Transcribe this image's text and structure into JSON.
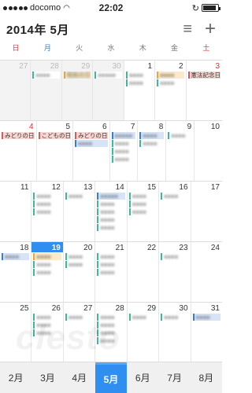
{
  "status": {
    "carrier": "docomo",
    "time": "22:02",
    "icons": [
      "signal-dots",
      "wifi-icon",
      "rotation-lock-icon",
      "battery-icon"
    ]
  },
  "header": {
    "title": "2014年 5月",
    "list_icon": "≡",
    "add_icon": "+"
  },
  "weekdays": [
    "日",
    "月",
    "火",
    "水",
    "木",
    "金",
    "土"
  ],
  "weeks": [
    [
      {
        "n": "27",
        "out": true,
        "events": []
      },
      {
        "n": "28",
        "out": true,
        "events": [
          {
            "t": "●●●●",
            "c": "teal",
            "b": true
          }
        ]
      },
      {
        "n": "29",
        "out": true,
        "events": [
          {
            "t": "昭和の日",
            "c": "orange",
            "b": true
          }
        ]
      },
      {
        "n": "30",
        "out": true,
        "events": [
          {
            "t": "●●●●●",
            "c": "teal",
            "b": true
          }
        ]
      },
      {
        "n": "1",
        "events": [
          {
            "t": "●●●●",
            "c": "teal",
            "b": true
          },
          {
            "t": "●●●●",
            "c": "teal",
            "b": true
          }
        ]
      },
      {
        "n": "2",
        "events": [
          {
            "t": "●●●●",
            "c": "orange",
            "b": true
          },
          {
            "t": "●●●●",
            "c": "teal",
            "b": true
          }
        ]
      },
      {
        "n": "3",
        "sat": true,
        "events": [
          {
            "t": "憲法記念日",
            "c": "red",
            "b": false
          }
        ]
      }
    ],
    [
      {
        "n": "4",
        "sun": true,
        "events": [
          {
            "t": "みどりの日",
            "c": "red",
            "b": false
          }
        ]
      },
      {
        "n": "5",
        "events": [
          {
            "t": "こどもの日",
            "c": "red",
            "b": false
          }
        ]
      },
      {
        "n": "6",
        "events": [
          {
            "t": "みどりの日",
            "c": "red",
            "b": false
          },
          {
            "t": "●●●●",
            "c": "blue",
            "b": true
          }
        ]
      },
      {
        "n": "7",
        "events": [
          {
            "t": "●●●●●",
            "c": "blue",
            "b": true
          },
          {
            "t": "●●●●",
            "c": "teal",
            "b": true
          },
          {
            "t": "●●●●",
            "c": "teal",
            "b": true
          },
          {
            "t": "●●●●",
            "c": "teal",
            "b": true
          }
        ]
      },
      {
        "n": "8",
        "events": [
          {
            "t": "●●●●",
            "c": "blue",
            "b": true
          },
          {
            "t": "●●●●",
            "c": "teal",
            "b": true
          }
        ]
      },
      {
        "n": "9",
        "events": [
          {
            "t": "●●●●",
            "c": "teal",
            "b": true
          }
        ]
      },
      {
        "n": "10",
        "events": []
      }
    ],
    [
      {
        "n": "11",
        "events": []
      },
      {
        "n": "12",
        "events": [
          {
            "t": "●●●●",
            "c": "teal",
            "b": true
          },
          {
            "t": "●●●●",
            "c": "teal",
            "b": true
          },
          {
            "t": "●●●●",
            "c": "teal",
            "b": true
          }
        ]
      },
      {
        "n": "13",
        "events": [
          {
            "t": "●●●●",
            "c": "teal",
            "b": true
          }
        ]
      },
      {
        "n": "14",
        "events": [
          {
            "t": "●●●●●",
            "c": "blue",
            "b": true
          },
          {
            "t": "●●●●",
            "c": "teal",
            "b": true
          },
          {
            "t": "●●●●",
            "c": "teal",
            "b": true
          },
          {
            "t": "●●●●",
            "c": "teal",
            "b": true
          },
          {
            "t": "●●●●",
            "c": "teal",
            "b": true
          }
        ]
      },
      {
        "n": "15",
        "events": [
          {
            "t": "●●●●",
            "c": "teal",
            "b": true
          },
          {
            "t": "●●●●",
            "c": "teal",
            "b": true
          },
          {
            "t": "●●●●",
            "c": "teal",
            "b": true
          }
        ]
      },
      {
        "n": "16",
        "events": [
          {
            "t": "●●●●",
            "c": "teal",
            "b": true
          }
        ]
      },
      {
        "n": "17",
        "events": []
      }
    ],
    [
      {
        "n": "18",
        "events": [
          {
            "t": "●●●●",
            "c": "blue",
            "b": true
          }
        ]
      },
      {
        "n": "19",
        "today": true,
        "events": [
          {
            "t": "●●●●",
            "c": "orange",
            "b": true
          },
          {
            "t": "●●●●",
            "c": "teal",
            "b": true
          },
          {
            "t": "●●●●",
            "c": "teal",
            "b": true
          }
        ]
      },
      {
        "n": "20",
        "events": [
          {
            "t": "●●●●",
            "c": "teal",
            "b": true
          },
          {
            "t": "●●●●",
            "c": "teal",
            "b": true
          }
        ]
      },
      {
        "n": "21",
        "events": [
          {
            "t": "●●●●",
            "c": "teal",
            "b": true
          },
          {
            "t": "●●●●",
            "c": "teal",
            "b": true
          },
          {
            "t": "●●●●",
            "c": "teal",
            "b": true
          }
        ]
      },
      {
        "n": "22",
        "events": []
      },
      {
        "n": "23",
        "events": [
          {
            "t": "●●●●",
            "c": "teal",
            "b": true
          }
        ]
      },
      {
        "n": "24",
        "events": []
      }
    ],
    [
      {
        "n": "25",
        "events": []
      },
      {
        "n": "26",
        "events": [
          {
            "t": "●●●●",
            "c": "teal",
            "b": true
          },
          {
            "t": "●●●●",
            "c": "teal",
            "b": true
          },
          {
            "t": "●●●●",
            "c": "teal",
            "b": true
          }
        ]
      },
      {
        "n": "27",
        "events": [
          {
            "t": "●●●●",
            "c": "teal",
            "b": true
          }
        ]
      },
      {
        "n": "28",
        "events": [
          {
            "t": "●●●●",
            "c": "teal",
            "b": true
          },
          {
            "t": "●●●●",
            "c": "teal",
            "b": true
          },
          {
            "t": "●●●●",
            "c": "teal",
            "b": true
          },
          {
            "t": "●●●●",
            "c": "teal",
            "b": true
          }
        ]
      },
      {
        "n": "29",
        "events": [
          {
            "t": "●●●●",
            "c": "teal",
            "b": true
          }
        ]
      },
      {
        "n": "30",
        "events": [
          {
            "t": "●●●●",
            "c": "teal",
            "b": true
          }
        ]
      },
      {
        "n": "31",
        "events": [
          {
            "t": "●●●●",
            "c": "blue",
            "b": true
          }
        ]
      }
    ]
  ],
  "month_tabs": [
    "2月",
    "3月",
    "4月",
    "5月",
    "6月",
    "7月",
    "8月"
  ],
  "active_tab": "5月",
  "watermark": "clesto"
}
